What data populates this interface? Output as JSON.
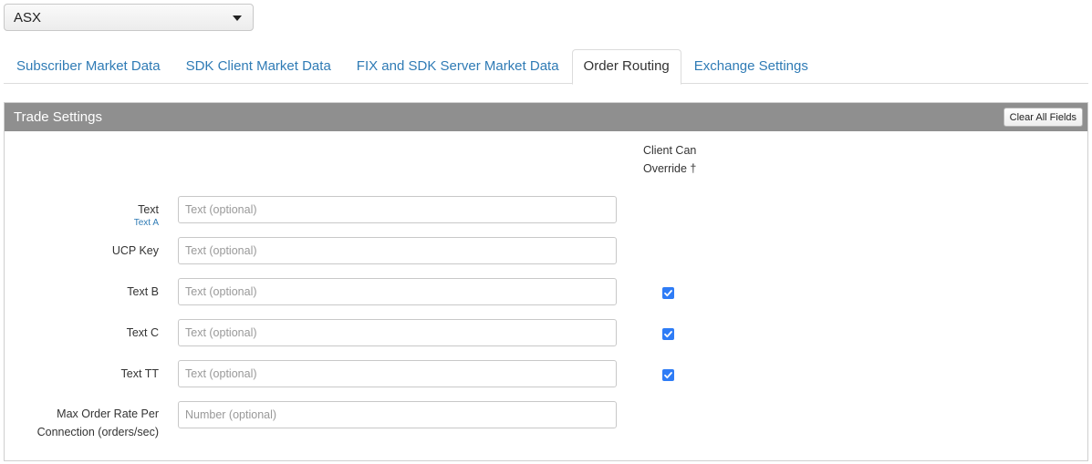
{
  "exchange_select": {
    "value": "ASX"
  },
  "tabs": [
    {
      "label": "Subscriber Market Data",
      "active": false
    },
    {
      "label": "SDK Client Market Data",
      "active": false
    },
    {
      "label": "FIX and SDK Server Market Data",
      "active": false
    },
    {
      "label": "Order Routing",
      "active": true
    },
    {
      "label": "Exchange Settings",
      "active": false
    }
  ],
  "panel": {
    "title": "Trade Settings",
    "clear_label": "Clear All Fields",
    "override_header_line1": "Client Can",
    "override_header_line2": "Override †"
  },
  "fields": [
    {
      "label": "Text",
      "sublabel": "Text A",
      "placeholder": "Text (optional)",
      "override": null
    },
    {
      "label": "UCP Key",
      "placeholder": "Text (optional)",
      "override": null
    },
    {
      "label": "Text B",
      "placeholder": "Text (optional)",
      "override": true
    },
    {
      "label": "Text C",
      "placeholder": "Text (optional)",
      "override": true
    },
    {
      "label": "Text TT",
      "placeholder": "Text (optional)",
      "override": true
    },
    {
      "label_line1": "Max Order Rate Per",
      "label_line2": "Connection (orders/sec)",
      "placeholder": "Number (optional)",
      "override": null
    }
  ],
  "colors": {
    "accent": "#2f7bb5",
    "header_bg": "#8f8f8f",
    "checkbox": "#2e7cf6"
  }
}
